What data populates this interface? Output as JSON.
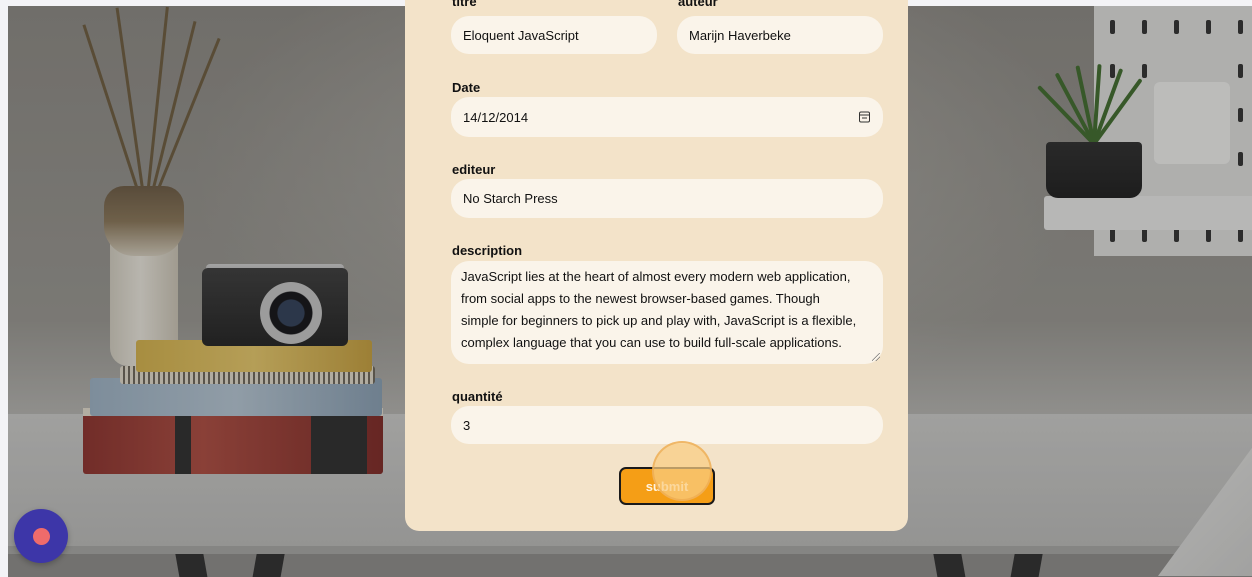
{
  "form": {
    "titre": {
      "label": "titre",
      "value": "Eloquent JavaScript"
    },
    "auteur": {
      "label": "auteur",
      "value": "Marijn Haverbeke"
    },
    "date": {
      "label": "Date",
      "value": "14/12/2014"
    },
    "editeur": {
      "label": "editeur",
      "value": "No Starch Press"
    },
    "description": {
      "label": "description",
      "lines": [
        "JavaScript lies at the heart of almost every modern web application,",
        "from social apps to the newest browser-based games. Though",
        "simple for beginners to pick up and play with, JavaScript is a flexible,",
        "complex language that you can use to build full-scale applications."
      ]
    },
    "quantite": {
      "label": "quantité",
      "value": "3"
    },
    "submit_label": "submit"
  },
  "colors": {
    "card": "#f3e3c9",
    "field": "#faf4ea",
    "submit": "#f59e16",
    "fab": "#3d36a8",
    "fab_dot": "#ef6b6b"
  },
  "icons": {
    "date_picker": "calendar-icon",
    "fab": "record-dot-icon"
  }
}
